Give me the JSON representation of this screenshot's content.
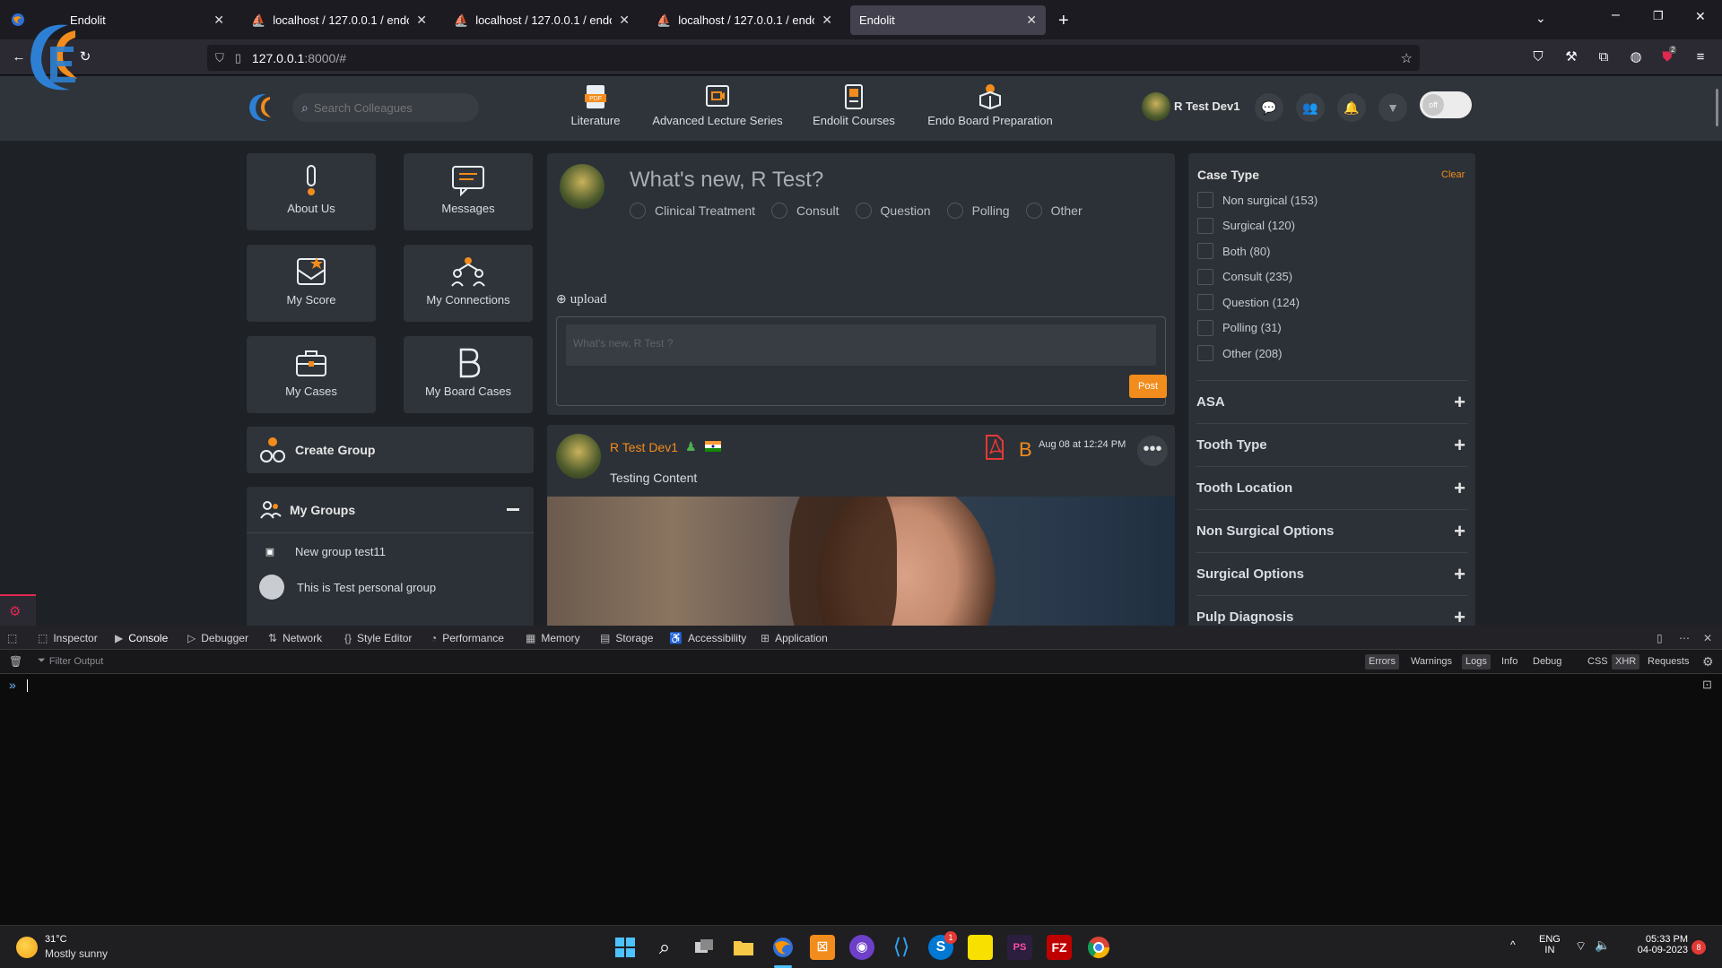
{
  "browser": {
    "tabs": [
      {
        "label": "Endolit",
        "active": false
      },
      {
        "label": "localhost / 127.0.0.1 / endolito_",
        "active": false
      },
      {
        "label": "localhost / 127.0.0.1 / endolito_",
        "active": false
      },
      {
        "label": "localhost / 127.0.0.1 / endolito_",
        "active": false
      },
      {
        "label": "Endolit",
        "active": true
      }
    ],
    "url": "127.0.0.1",
    "url_rest": ":8000/#",
    "extension_badge": "2"
  },
  "site": {
    "search_placeholder": "Search Colleagues",
    "nav": [
      {
        "label": "Literature",
        "icon": "pdf-doc-icon"
      },
      {
        "label": "Advanced Lecture Series",
        "icon": "video-lecture-icon"
      },
      {
        "label": "Endolit Courses",
        "icon": "book-icon"
      },
      {
        "label": "Endo Board Preparation",
        "icon": "board-icon"
      }
    ],
    "user_name": "R Test Dev1",
    "toggle_label": "off",
    "tiles": [
      {
        "label": "About Us",
        "icon": "info-icon"
      },
      {
        "label": "Messages",
        "icon": "messages-icon"
      },
      {
        "label": "My Score",
        "icon": "score-icon"
      },
      {
        "label": "My Connections",
        "icon": "connections-icon"
      },
      {
        "label": "My Cases",
        "icon": "briefcase-icon"
      },
      {
        "label": "My Board Cases",
        "icon": "board-b-icon"
      }
    ],
    "create_group": "Create Group",
    "my_groups": "My Groups",
    "groups": [
      "New group test11",
      "This is Test personal group"
    ],
    "composer": {
      "title": "What's new, R Test?",
      "types": [
        "Clinical Treatment",
        "Consult",
        "Question",
        "Polling",
        "Other"
      ],
      "upload": "upload",
      "placeholder": "What's new, R Test ?",
      "post": "Post"
    },
    "post": {
      "author": "R Test Dev1",
      "date": "Aug 08 at 12:24 PM",
      "badge_letter": "B",
      "content": "Testing Content"
    },
    "filters": {
      "title": "Case Type",
      "clear": "Clear",
      "options": [
        "Non surgical (153)",
        "Surgical (120)",
        "Both (80)",
        "Consult (235)",
        "Question (124)",
        "Polling (31)",
        "Other (208)"
      ],
      "sections": [
        "ASA",
        "Tooth Type",
        "Tooth Location",
        "Non Surgical Options",
        "Surgical Options",
        "Pulp Diagnosis"
      ]
    },
    "colors": {
      "accent": "#f28c1c",
      "header": "#2f343a",
      "bg": "#1e2126"
    }
  },
  "devtools": {
    "tabs": [
      "Inspector",
      "Console",
      "Debugger",
      "Network",
      "Style Editor",
      "Performance",
      "Memory",
      "Storage",
      "Accessibility",
      "Application"
    ],
    "active_tab": "Console",
    "filter_placeholder": "Filter Output",
    "levels": [
      "Errors",
      "Warnings",
      "Logs",
      "Info",
      "Debug"
    ],
    "extra": [
      "CSS",
      "XHR",
      "Requests"
    ]
  },
  "taskbar": {
    "temp": "31°C",
    "weather": "Mostly sunny",
    "lang1": "ENG",
    "lang2": "IN",
    "time": "05:33 PM",
    "date": "04-09-2023",
    "notif_count": "8",
    "skype_badge": "1"
  }
}
